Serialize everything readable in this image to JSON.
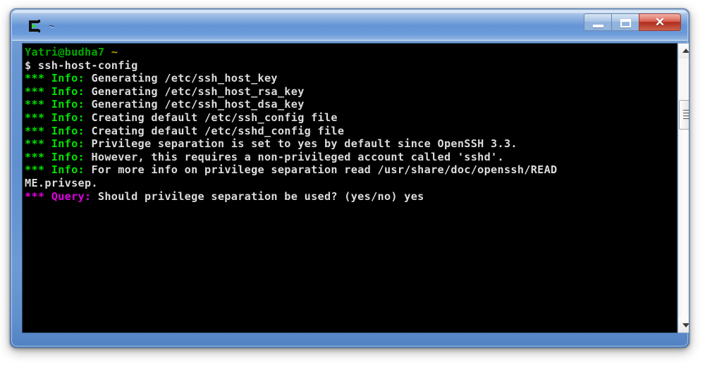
{
  "window": {
    "title": "~",
    "icon": "cygwin-terminal-icon",
    "controls": {
      "minimize_label": "Minimize",
      "maximize_label": "Maximize",
      "close_label": "✕"
    },
    "accent_color": "#6495d6",
    "close_color": "#d04330"
  },
  "terminal": {
    "background": "#000000",
    "foreground": "#dcdcdc",
    "colors": {
      "prompt_green": "#00a800",
      "tilde_yellow": "#a8a800",
      "info_green": "#00e000",
      "query_magenta": "#e000e0",
      "text_white": "#dcdcdc"
    },
    "lines": [
      {
        "segments": [
          {
            "text": "Yatri@budha7 ",
            "color": "prompt"
          },
          {
            "text": "~",
            "color": "tilde"
          }
        ]
      },
      {
        "segments": [
          {
            "text": "$ ssh-host-config",
            "color": "white"
          }
        ]
      },
      {
        "segments": [
          {
            "text": "*** Info:",
            "color": "ginfo"
          },
          {
            "text": " Generating /etc/ssh_host_key",
            "color": "white"
          }
        ]
      },
      {
        "segments": [
          {
            "text": "*** Info:",
            "color": "ginfo"
          },
          {
            "text": " Generating /etc/ssh_host_rsa_key",
            "color": "white"
          }
        ]
      },
      {
        "segments": [
          {
            "text": "*** Info:",
            "color": "ginfo"
          },
          {
            "text": " Generating /etc/ssh_host_dsa_key",
            "color": "white"
          }
        ]
      },
      {
        "segments": [
          {
            "text": "*** Info:",
            "color": "ginfo"
          },
          {
            "text": " Creating default /etc/ssh_config file",
            "color": "white"
          }
        ]
      },
      {
        "segments": [
          {
            "text": "*** Info:",
            "color": "ginfo"
          },
          {
            "text": " Creating default /etc/sshd_config file",
            "color": "white"
          }
        ]
      },
      {
        "segments": [
          {
            "text": "*** Info:",
            "color": "ginfo"
          },
          {
            "text": " Privilege separation is set to yes by default since OpenSSH 3.3.",
            "color": "white"
          }
        ]
      },
      {
        "segments": [
          {
            "text": "*** Info:",
            "color": "ginfo"
          },
          {
            "text": " However, this requires a non-privileged account called 'sshd'.",
            "color": "white"
          }
        ]
      },
      {
        "segments": [
          {
            "text": "*** Info:",
            "color": "ginfo"
          },
          {
            "text": " For more info on privilege separation read /usr/share/doc/openssh/READ",
            "color": "white"
          }
        ]
      },
      {
        "segments": [
          {
            "text": "ME.privsep.",
            "color": "white"
          }
        ]
      },
      {
        "segments": [
          {
            "text": "*** Query:",
            "color": "magenta"
          },
          {
            "text": " Should privilege separation be used? (yes/no) yes",
            "color": "white"
          }
        ]
      }
    ]
  },
  "scrollbar": {
    "up_arrow": "▲",
    "down_arrow": "▼",
    "thumb_position_percent": 16
  }
}
